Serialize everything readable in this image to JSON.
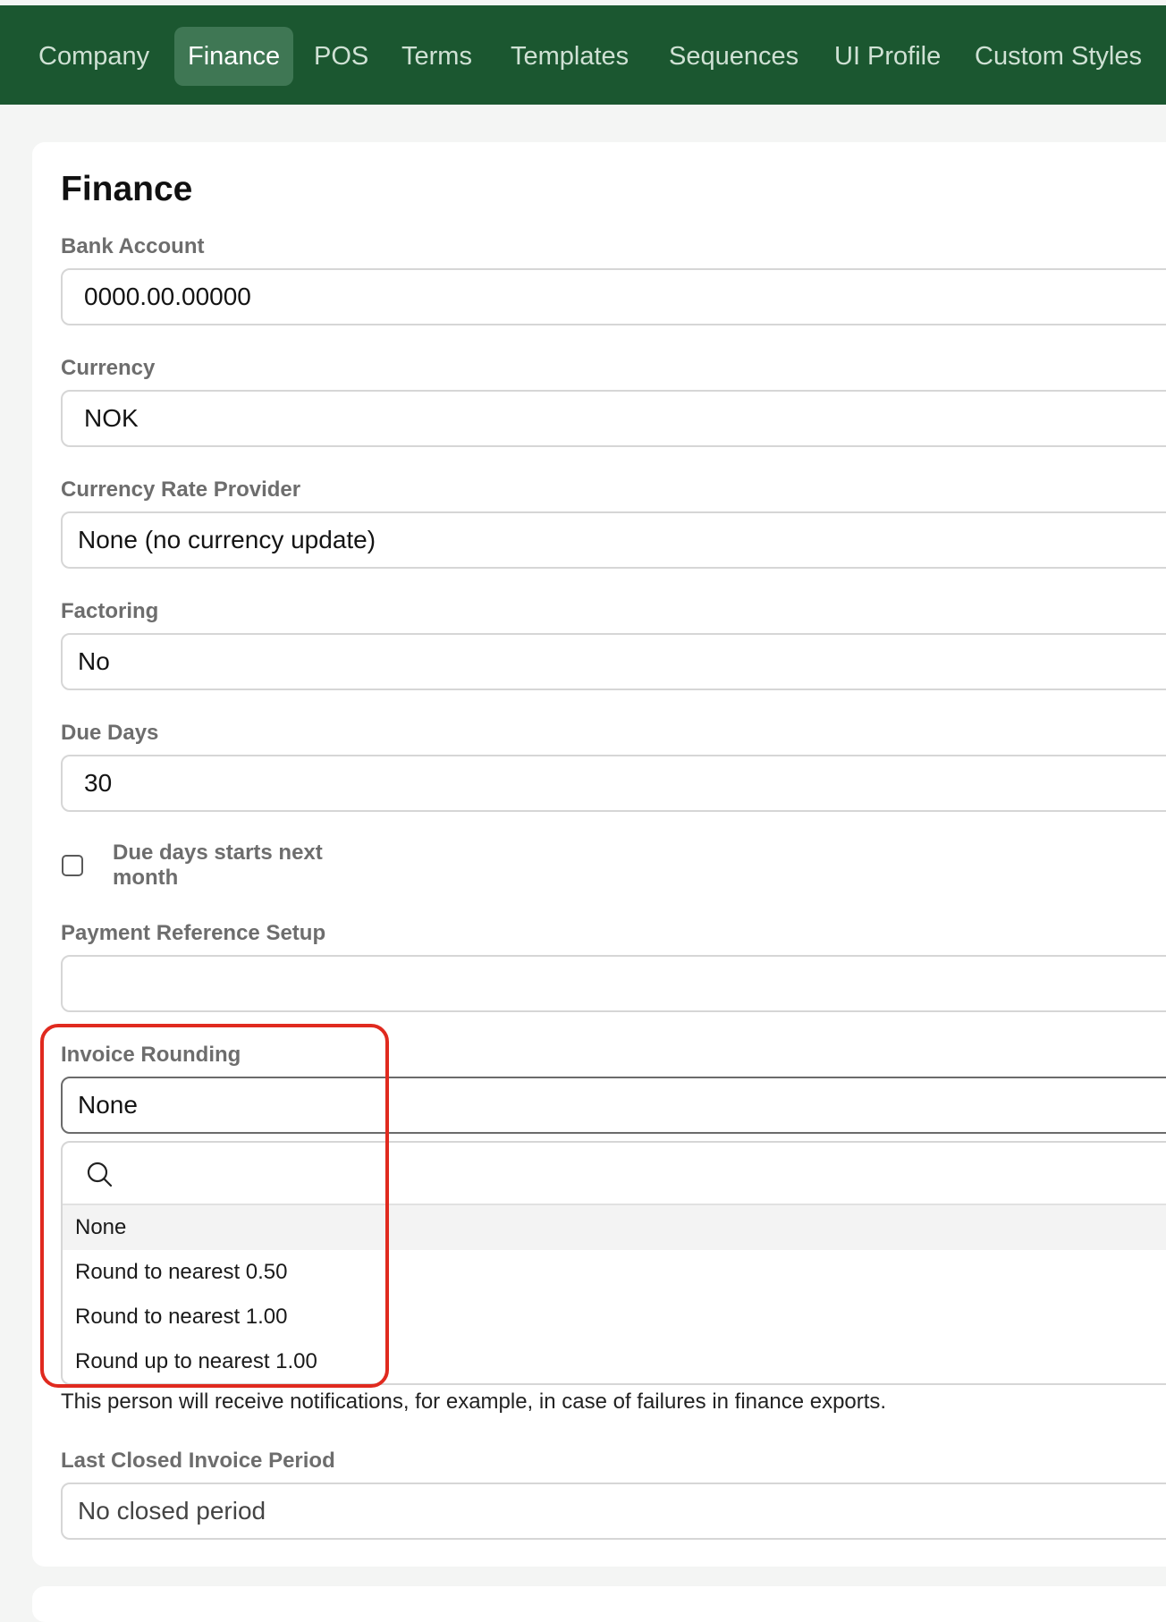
{
  "nav": {
    "tabs": [
      {
        "label": "Company"
      },
      {
        "label": "Finance"
      },
      {
        "label": "POS"
      },
      {
        "label": "Terms"
      },
      {
        "label": "Templates"
      },
      {
        "label": "Sequences"
      },
      {
        "label": "UI Profile"
      },
      {
        "label": "Custom Styles"
      }
    ],
    "active_tab": "Finance"
  },
  "section": {
    "title": "Finance"
  },
  "fields": {
    "bank_account": {
      "label": "Bank Account",
      "value": "0000.00.00000"
    },
    "currency": {
      "label": "Currency",
      "value": "NOK"
    },
    "currency_rate_provider": {
      "label": "Currency Rate Provider",
      "value": "None (no currency update)"
    },
    "factoring": {
      "label": "Factoring",
      "value": "No"
    },
    "due_days": {
      "label": "Due Days",
      "value": "30"
    },
    "due_days_next_month": {
      "label": "Due days starts next month",
      "checked": false
    },
    "payment_reference_setup": {
      "label": "Payment Reference Setup",
      "value": ""
    },
    "invoice_rounding": {
      "label": "Invoice Rounding",
      "value": "None",
      "search_placeholder": "",
      "options": [
        {
          "label": "None"
        },
        {
          "label": "Round to nearest 0.50"
        },
        {
          "label": "Round to nearest 1.00"
        },
        {
          "label": "Round up to nearest 1.00"
        }
      ]
    },
    "notification_helper": "This person will receive notifications, for example, in case of failures in finance exports.",
    "last_closed_invoice_period": {
      "label": "Last Closed Invoice Period",
      "value": "No closed period"
    }
  },
  "colors": {
    "nav_background": "#1b5730",
    "active_tab": "#3f7754",
    "highlight_border": "#e02a1f"
  }
}
